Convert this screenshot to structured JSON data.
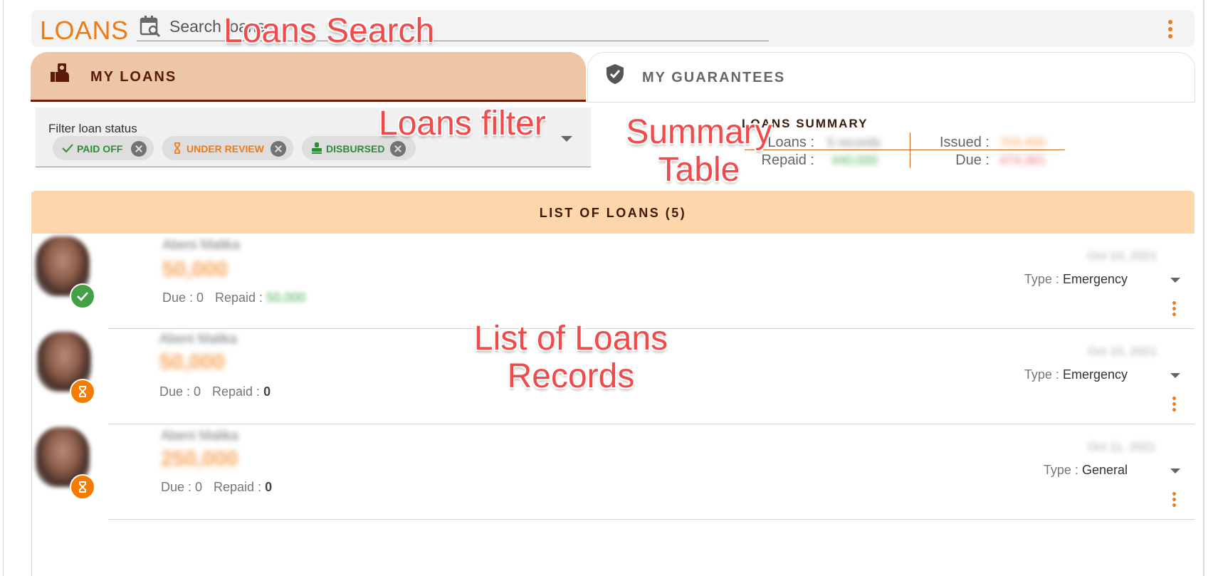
{
  "app": {
    "title": "LOANS"
  },
  "search": {
    "placeholder": "Search loans"
  },
  "tabs": [
    {
      "label": "MY LOANS",
      "icon": "loan-hand-icon",
      "active": true
    },
    {
      "label": "MY GUARANTEES",
      "icon": "shield-check-icon",
      "active": false
    }
  ],
  "filter": {
    "label": "Filter loan status",
    "chips": [
      {
        "label": "PAID OFF",
        "icon": "check-icon",
        "color": "#2e8b3c"
      },
      {
        "label": "UNDER REVIEW",
        "icon": "hourglass-icon",
        "color": "#f07b14"
      },
      {
        "label": "DISBURSED",
        "icon": "stamp-icon",
        "color": "#2e8b3c"
      }
    ]
  },
  "summary": {
    "title": "LOANS SUMMARY",
    "loans_label": "Loans :",
    "loans_value": "5 records",
    "issued_label": "Issued :",
    "issued_value": "703,400",
    "repaid_label": "Repaid :",
    "repaid_value": "440,000",
    "due_label": "Due :",
    "due_value": "474,361"
  },
  "list": {
    "title": "LIST OF LOANS (5)",
    "loans": [
      {
        "name": "Abeni Malika",
        "amount": "50,000",
        "due_label": "Due :",
        "due_value": "0",
        "repaid_label": "Repaid :",
        "repaid_value": "50,000",
        "date": "Oct 10, 2021",
        "type_label": "Type :",
        "type_value": "Emergency",
        "status": "paid-off"
      },
      {
        "name": "Abeni Malika",
        "amount": "50,000",
        "due_label": "Due :",
        "due_value": "0",
        "repaid_label": "Repaid :",
        "repaid_value": "0",
        "date": "Oct 10, 2021",
        "type_label": "Type :",
        "type_value": "Emergency",
        "status": "under-review"
      },
      {
        "name": "Abeni Malika",
        "amount": "250,000",
        "due_label": "Due :",
        "due_value": "0",
        "repaid_label": "Repaid :",
        "repaid_value": "0",
        "date": "Oct 11, 2021",
        "type_label": "Type :",
        "type_value": "General",
        "status": "under-review"
      }
    ]
  },
  "annotations": {
    "search": "Loans Search",
    "filter": "Loans filter",
    "summary_line1": "Summary",
    "summary_line2": "Table",
    "list_line1": "List of Loans",
    "list_line2": "Records"
  },
  "colors": {
    "accent": "#f07b14",
    "tab_active_bg": "#ecc6a6",
    "tab_active_underline": "#6e1f0a",
    "list_header_bg": "#fdd6ac",
    "paid_green": "#43a047",
    "review_orange": "#f57c00",
    "annotation_red": "#f14a4a"
  }
}
